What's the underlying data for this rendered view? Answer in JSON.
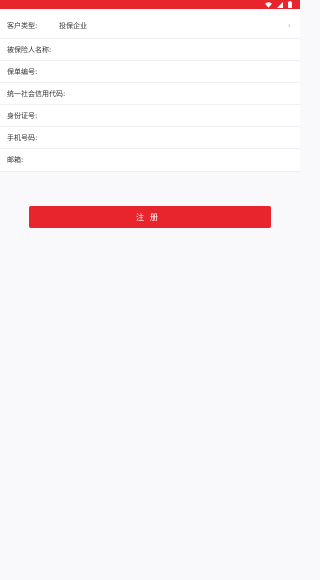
{
  "status_bar": {
    "color": "#e8242c",
    "icons": [
      "wifi-icon",
      "signal-icon",
      "battery-icon"
    ]
  },
  "form": {
    "customer_type": {
      "label": "客户类型:",
      "value": "投保企业"
    },
    "insured_name": {
      "label": "被保险人名称:",
      "value": "",
      "placeholder": ""
    },
    "policy_number": {
      "label": "保单编号:",
      "value": "",
      "placeholder": ""
    },
    "credit_code": {
      "label": "统一社会信用代码:",
      "value": "",
      "placeholder": ""
    },
    "id_number": {
      "label": "身份证号:",
      "value": "",
      "placeholder": ""
    },
    "phone": {
      "label": "手机号码:",
      "value": "",
      "placeholder": ""
    },
    "email": {
      "label": "邮箱:",
      "value": "",
      "placeholder": ""
    }
  },
  "register_button": {
    "label": "注册",
    "color": "#e8242c"
  }
}
